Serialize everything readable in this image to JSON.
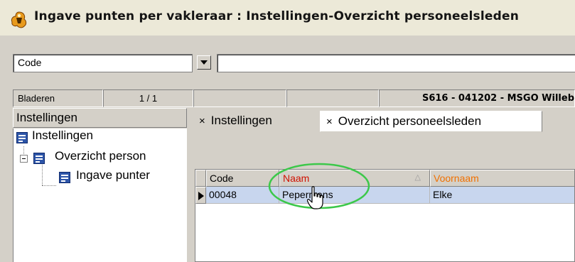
{
  "window": {
    "title": "Ingave punten per vakleraar : Instellingen-Overzicht personeelsleden",
    "icon": "app-logo-icon"
  },
  "search": {
    "field_value": "Code",
    "query_value": ""
  },
  "status": {
    "mode": "Bladeren",
    "page": "1 / 1",
    "cell3": "",
    "cell4": "",
    "info": "S616 - 041202 - MSGO Willeb"
  },
  "tree": {
    "header": "Instellingen",
    "items": [
      {
        "label": "Instellingen",
        "icon": "form-icon",
        "level": 0
      },
      {
        "label": "Overzicht person",
        "icon": "form-icon",
        "level": 1,
        "expanded": true
      },
      {
        "label": "Ingave punter",
        "icon": "form-icon",
        "level": 2
      }
    ]
  },
  "tabs": [
    {
      "label": "Instellingen",
      "close": "×",
      "active": false
    },
    {
      "label": "Overzicht personeelsleden",
      "close": "×",
      "active": true
    }
  ],
  "grid": {
    "columns": [
      {
        "label": "Code",
        "color": "#000000"
      },
      {
        "label": "Naam",
        "color": "#d01000",
        "sort": "ascending"
      },
      {
        "label": "Voornaam",
        "color": "#f07000"
      }
    ],
    "sort_indicator": "△",
    "rows": [
      {
        "code": "00048",
        "naam": "Pepermans",
        "voornaam": "Elke",
        "selected": true
      }
    ]
  },
  "colors": {
    "selected_row": "#c8d6ee",
    "highlight_ellipse": "#3cc84a",
    "chrome": "#d4d0c8"
  }
}
